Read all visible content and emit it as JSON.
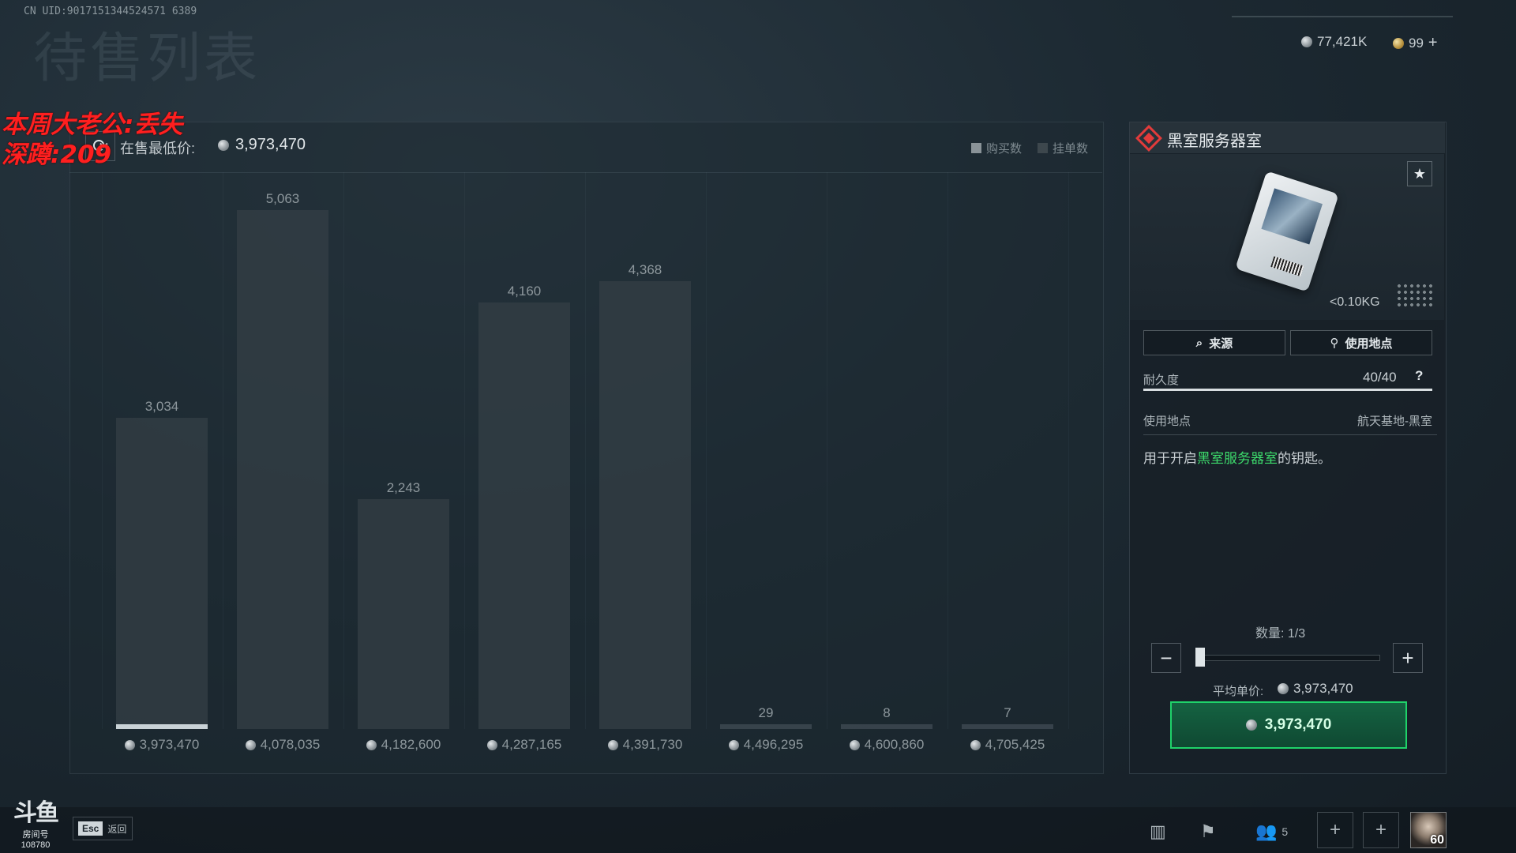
{
  "top": {
    "uid": "CN UID:9017151344524571 6389",
    "page_title": "待售列表",
    "currency_silver": "77,421K",
    "currency_gold": "99",
    "plus": "+"
  },
  "overlay": {
    "line1": "本周大老公:丢失",
    "line2": "深蹲:209"
  },
  "chart_header": {
    "lowest_label": "在售最低价:",
    "lowest_value": "3,973,470",
    "legend_buy": "购买数",
    "legend_list": "挂单数"
  },
  "chart_data": {
    "type": "bar",
    "categories": [
      "3,973,470",
      "4,078,035",
      "4,182,600",
      "4,287,165",
      "4,391,730",
      "4,496,295",
      "4,600,860",
      "4,705,425"
    ],
    "values": [
      3034,
      5063,
      2243,
      4160,
      4368,
      29,
      8,
      7
    ],
    "labels": [
      "3,034",
      "5,063",
      "2,243",
      "4,160",
      "4,368",
      "29",
      "8",
      "7"
    ],
    "ylim": [
      0,
      5063
    ],
    "selected_index": 0
  },
  "item": {
    "name": "黑室服务器室",
    "weight": "<0.10KG",
    "source_btn": "来源",
    "location_btn": "使用地点",
    "durability_label": "耐久度",
    "durability_value": "40/40",
    "durability_fraction": 1.0,
    "help": "?",
    "use_label": "使用地点",
    "use_value": "航天基地-黑室",
    "desc_prefix": "用于开启",
    "desc_highlight": "黑室服务器室",
    "desc_suffix": "的钥匙。",
    "qty_label": "数量:",
    "qty_value": "1/3",
    "avg_label": "平均单价:",
    "avg_value": "3,973,470",
    "buy_value": "3,973,470",
    "accent_color": "#1fd26a",
    "highlight_color": "#3ddc6c",
    "rarity_color": "#e23b3b"
  },
  "bottom": {
    "douyu_logo": "斗鱼",
    "douyu_room_label": "房间号",
    "douyu_room": "108780",
    "esc_key": "Esc",
    "esc_text": "返回",
    "squad_count": "5",
    "level": "60"
  },
  "icons": {
    "refresh": "refresh-icon",
    "star": "star-icon",
    "search": "search-icon",
    "pin": "pin-icon",
    "stats": "bar-chart-icon",
    "flag": "flag-icon",
    "people": "people-icon"
  }
}
